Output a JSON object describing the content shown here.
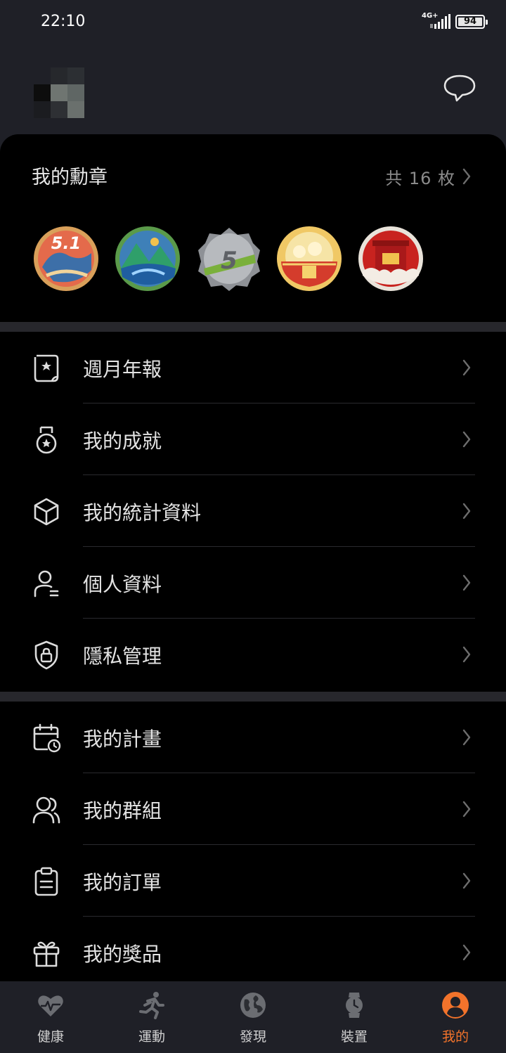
{
  "status_bar": {
    "time": "22:10",
    "network": "4G+",
    "battery": "94"
  },
  "medals": {
    "title": "我的勳章",
    "count_label": "共 16 枚",
    "badges": [
      {
        "icon": "labor-day-5-1-medal-icon",
        "text": "5.1"
      },
      {
        "icon": "mountain-landscape-medal-icon"
      },
      {
        "icon": "silver-5-medal-icon",
        "text": "5"
      },
      {
        "icon": "golden-bowl-medal-icon"
      },
      {
        "icon": "red-ox-new-year-medal-icon"
      }
    ]
  },
  "menu_group_1": [
    {
      "label": "週月年報",
      "icon": "report-book-icon"
    },
    {
      "label": "我的成就",
      "icon": "medal-icon"
    },
    {
      "label": "我的統計資料",
      "icon": "cube-icon"
    },
    {
      "label": "個人資料",
      "icon": "person-icon"
    },
    {
      "label": "隱私管理",
      "icon": "shield-lock-icon"
    }
  ],
  "menu_group_2": [
    {
      "label": "我的計畫",
      "icon": "calendar-clock-icon"
    },
    {
      "label": "我的群組",
      "icon": "group-icon"
    },
    {
      "label": "我的訂單",
      "icon": "clipboard-icon"
    },
    {
      "label": "我的獎品",
      "icon": "gift-icon"
    }
  ],
  "tabs": [
    {
      "label": "健康",
      "icon": "heart-pulse-icon"
    },
    {
      "label": "運動",
      "icon": "running-icon"
    },
    {
      "label": "發現",
      "icon": "globe-icon"
    },
    {
      "label": "裝置",
      "icon": "watch-icon"
    },
    {
      "label": "我的",
      "icon": "profile-icon",
      "active": true
    }
  ],
  "colors": {
    "accent": "#f2732b",
    "background": "#000000",
    "header": "#1f2027",
    "divider": "#27272c"
  }
}
